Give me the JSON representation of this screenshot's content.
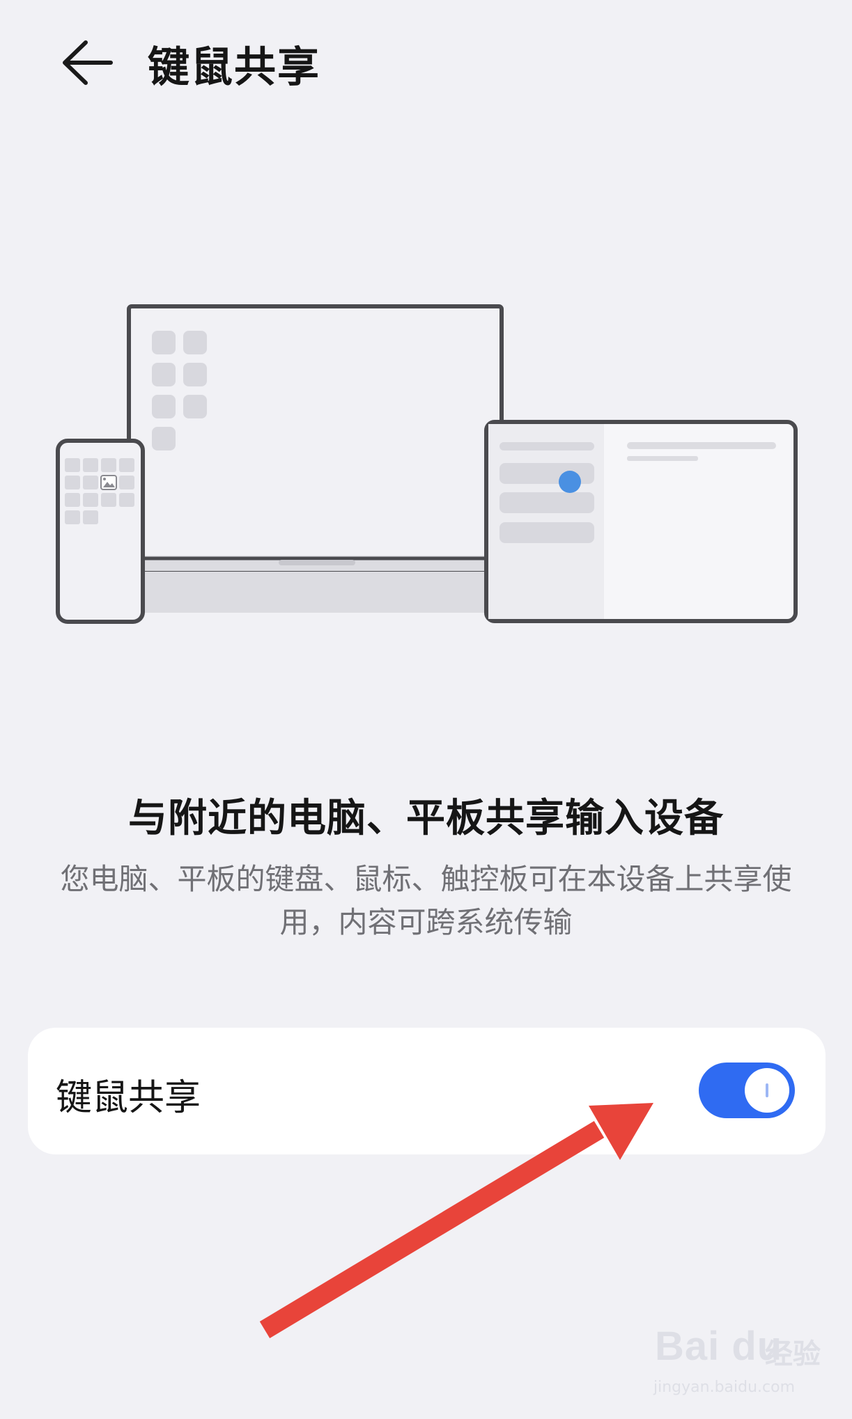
{
  "header": {
    "back_icon": "arrow-left-icon",
    "title": "键鼠共享"
  },
  "illustration": {
    "devices": [
      "phone",
      "laptop",
      "tablet"
    ],
    "accent_color": "#4a90e2"
  },
  "description": {
    "headline": "与附近的电脑、平板共享输入设备",
    "body": "您电脑、平板的键盘、鼠标、触控板可在本设备上共享使用，内容可跨系统传输"
  },
  "setting": {
    "label": "键鼠共享",
    "toggle_on": true,
    "toggle_color": "#2f6bf2"
  },
  "annotation": {
    "arrow_color": "#e8443a"
  },
  "watermark": {
    "logo": "Bai du",
    "cn": "经验",
    "url": "jingyan.baidu.com"
  }
}
